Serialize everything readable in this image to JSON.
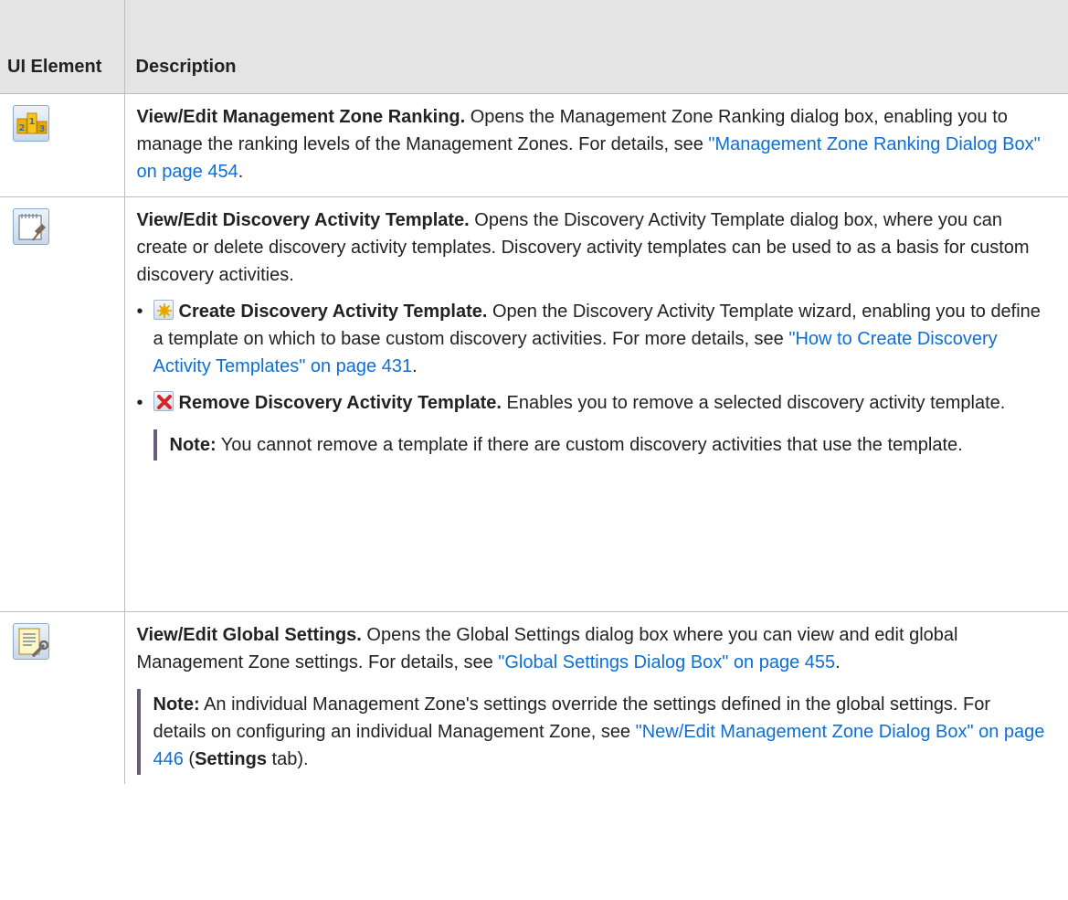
{
  "header": {
    "col1": "UI Element",
    "col2": "Description"
  },
  "rows": [
    {
      "icon": "management-zone-ranking-icon",
      "title": "View/Edit Management Zone Ranking.",
      "text": " Opens the Management Zone Ranking dialog box, enabling you to manage the ranking levels of the Management Zones. For details, see ",
      "link": "\"Management Zone Ranking Dialog Box\" on page 454",
      "tail": "."
    },
    {
      "icon": "discovery-activity-template-icon",
      "title": "View/Edit Discovery Activity Template.",
      "text": " Opens the Discovery Activity Template dialog box, where you can create or delete discovery activity templates. Discovery activity templates can be used to as a basis for custom discovery activities.",
      "bullets": [
        {
          "icon": "create-template-icon",
          "title": "Create Discovery Activity Template.",
          "text": " Open the Discovery Activity Template wizard, enabling you to define a template on which to base custom discovery activities. For more details, see ",
          "link": "\"How to Create Discovery Activity Templates\" on page 431",
          "tail": "."
        },
        {
          "icon": "remove-template-icon",
          "title": "Remove Discovery Activity Template.",
          "text": " Enables you to remove a selected discovery activity template.",
          "note_label": "Note:",
          "note_text": " You cannot remove a template if there are custom discovery activities that use the template."
        }
      ]
    },
    {
      "icon": "global-settings-icon",
      "title": "View/Edit Global Settings.",
      "text": " Opens the Global Settings dialog box where you can view and edit global Management Zone settings. For details, see ",
      "link": "\"Global Settings Dialog Box\" on page 455",
      "tail": ".",
      "note_label": "Note:",
      "note_text": " An individual Management Zone's settings override the settings defined in the global settings. For details on configuring an individual Management Zone, see ",
      "note_link": "\"New/Edit Management Zone Dialog Box\" on page 446",
      "note_tail_open": " (",
      "note_bold": "Settings",
      "note_tail_close": " tab)."
    }
  ],
  "colors": {
    "link": "#0d6fd6",
    "header_bg": "#e4e4e4",
    "note_bar": "#6a5d7b"
  }
}
